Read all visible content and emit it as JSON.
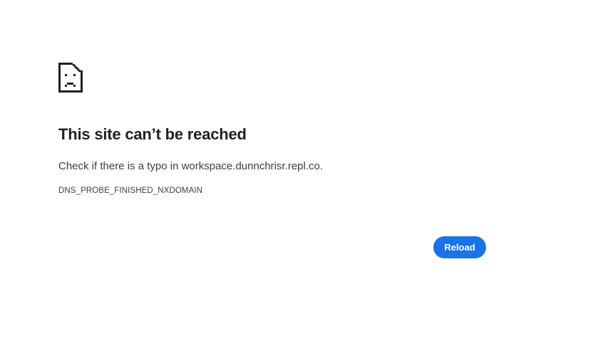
{
  "icon": {
    "name": "sad-file-icon",
    "color": "#202124"
  },
  "error": {
    "title": "This site can’t be reached",
    "message": "Check if there is a typo in workspace.dunnchrisr.repl.co.",
    "code": "DNS_PROBE_FINISHED_NXDOMAIN"
  },
  "actions": {
    "reload_label": "Reload"
  },
  "colors": {
    "accent": "#1a73e8",
    "text": "#202124",
    "secondary_text": "#3c4043",
    "background": "#ffffff"
  }
}
